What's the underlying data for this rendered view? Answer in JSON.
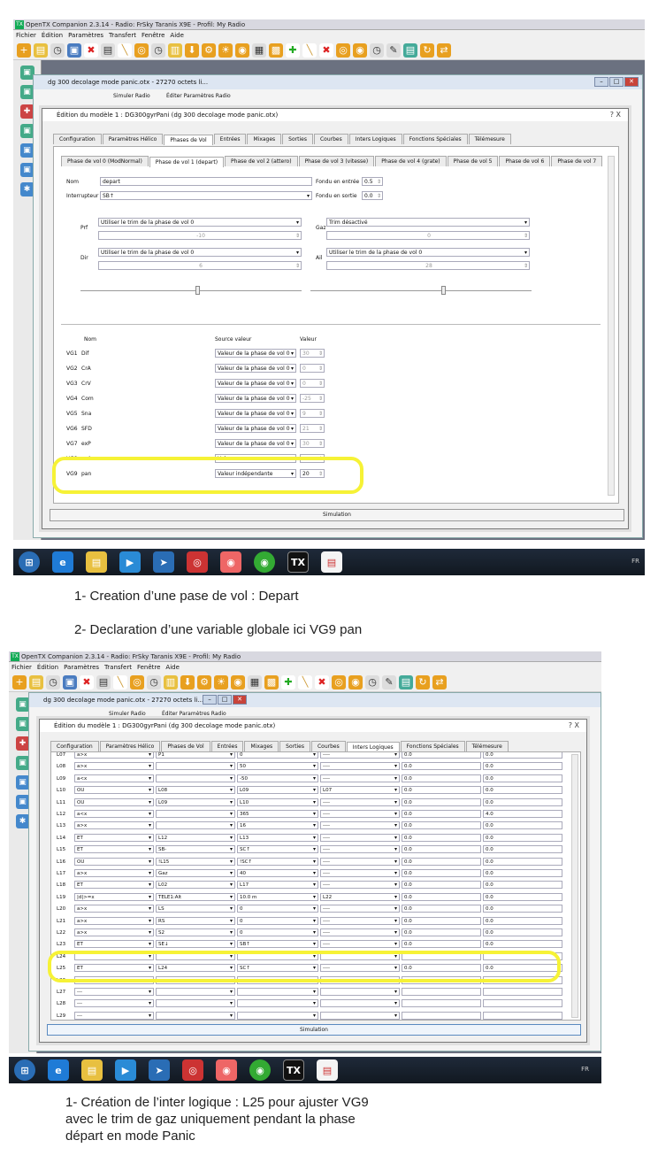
{
  "app_title": "OpenTX Companion 2.3.14 - Radio: FrSky Taranis X9E - Profil: My Radio",
  "menu": [
    "Fichier",
    "Édition",
    "Paramètres",
    "Transfert",
    "Fenêtre",
    "Aide"
  ],
  "mdi_title": "dg 300 decolage mode panic.otx - 27270 octets li...",
  "mdi_actions": {
    "simulate": "Simuler Radio",
    "edit_settings": "Éditer Paramètres Radio"
  },
  "dialog_title": "Édition du modèle 1 : DG300gyrPani   (dg 300 decolage mode panic.otx)",
  "dialog_controls": "?   X",
  "model_tabs": [
    "Configuration",
    "Paramètres Hélico",
    "Phases de Vol",
    "Entrées",
    "Mixages",
    "Sorties",
    "Courbes",
    "Inters Logiques",
    "Fonctions Spéciales",
    "Télémesure"
  ],
  "phase_tabs": [
    "Phase de vol 0 (ModNormal)",
    "Phase de vol 1 (depart)",
    "Phase de vol 2 (attero)",
    "Phase de vol 3 (vitesse)",
    "Phase de vol 4 (grate)",
    "Phase de vol 5",
    "Phase de vol 6",
    "Phase de vol 7"
  ],
  "phase": {
    "name_label": "Nom",
    "name_value": "depart",
    "switch_label": "Interrupteur",
    "switch_value": "SB↑",
    "fade_in_label": "Fondu en entrée",
    "fade_in_value": "0.5",
    "fade_out_label": "Fondu en sortie",
    "fade_out_value": "0.0",
    "trims": [
      {
        "label": "Prf",
        "mode": "Utiliser le trim de la phase de vol 0",
        "value": "-10"
      },
      {
        "label": "Dir",
        "mode": "Utiliser le trim de la phase de vol 0",
        "value": "6"
      },
      {
        "label": "Gaz",
        "mode": "Trim désactivé",
        "value": "0"
      },
      {
        "label": "Ail",
        "mode": "Utiliser le trim de la phase de vol 0",
        "value": "28"
      }
    ]
  },
  "gvars_header": {
    "name": "Nom",
    "source": "Source valeur",
    "value": "Valeur"
  },
  "gvars": [
    {
      "id": "VG1",
      "name": "Dif",
      "source": "Valeur de la phase de vol 0",
      "value": "30"
    },
    {
      "id": "VG2",
      "name": "CrA",
      "source": "Valeur de la phase de vol 0",
      "value": "0"
    },
    {
      "id": "VG3",
      "name": "CrV",
      "source": "Valeur de la phase de vol 0",
      "value": "0"
    },
    {
      "id": "VG4",
      "name": "Com",
      "source": "Valeur de la phase de vol 0",
      "value": "-25"
    },
    {
      "id": "VG5",
      "name": "Sna",
      "source": "Valeur de la phase de vol 0",
      "value": "9"
    },
    {
      "id": "VG6",
      "name": "SFD",
      "source": "Valeur de la phase de vol 0",
      "value": "21"
    },
    {
      "id": "VG7",
      "name": "exP",
      "source": "Valeur de la phase de vol 0",
      "value": "30"
    },
    {
      "id": "VG8",
      "name": "exA",
      "source": "Val...",
      "value": ""
    },
    {
      "id": "VG9",
      "name": "pan",
      "source": "Valeur indépendante",
      "value": "20"
    }
  ],
  "simulation_label": "Simulation",
  "taskbar_lang": "FR",
  "caption1": "1- Creation d’une pase de vol : Depart",
  "caption2": "2- Declaration d’une variable globale ici VG9 pan",
  "logic_switches": [
    {
      "id": "L07",
      "func": "a>x",
      "v1": "P1",
      "v2": "0",
      "and": "----",
      "dur": "0.0",
      "delay": "0.0"
    },
    {
      "id": "L08",
      "func": "a>x",
      "v1": "",
      "v2": "50",
      "and": "----",
      "dur": "0.0",
      "delay": "0.0"
    },
    {
      "id": "L09",
      "func": "a<x",
      "v1": "",
      "v2": "-50",
      "and": "----",
      "dur": "0.0",
      "delay": "0.0"
    },
    {
      "id": "L10",
      "func": "OU",
      "v1": "L08",
      "v2": "L09",
      "and": "L07",
      "dur": "0.0",
      "delay": "0.0"
    },
    {
      "id": "L11",
      "func": "OU",
      "v1": "L09",
      "v2": "L10",
      "and": "----",
      "dur": "0.0",
      "delay": "0.0"
    },
    {
      "id": "L12",
      "func": "a<x",
      "v1": "",
      "v2": "365",
      "and": "----",
      "dur": "0.0",
      "delay": "4.0"
    },
    {
      "id": "L13",
      "func": "a>x",
      "v1": "",
      "v2": "16",
      "and": "----",
      "dur": "0.0",
      "delay": "0.0"
    },
    {
      "id": "L14",
      "func": "ET",
      "v1": "L12",
      "v2": "L13",
      "and": "----",
      "dur": "0.0",
      "delay": "0.0"
    },
    {
      "id": "L15",
      "func": "ET",
      "v1": "SB-",
      "v2": "SC↑",
      "and": "----",
      "dur": "0.0",
      "delay": "0.0"
    },
    {
      "id": "L16",
      "func": "OU",
      "v1": "!L15",
      "v2": "!SC↑",
      "and": "----",
      "dur": "0.0",
      "delay": "0.0"
    },
    {
      "id": "L17",
      "func": "a>x",
      "v1": "Gaz",
      "v2": "40",
      "and": "----",
      "dur": "0.0",
      "delay": "0.0"
    },
    {
      "id": "L18",
      "func": "ET",
      "v1": "L02",
      "v2": "L17",
      "and": "----",
      "dur": "0.0",
      "delay": "0.0"
    },
    {
      "id": "L19",
      "func": "|d|>=x",
      "v1": "TELE1:Alt",
      "v2": "10.0 m",
      "and": "L22",
      "dur": "0.0",
      "delay": "0.0"
    },
    {
      "id": "L20",
      "func": "a>x",
      "v1": "LS",
      "v2": "0",
      "and": "----",
      "dur": "0.0",
      "delay": "0.0"
    },
    {
      "id": "L21",
      "func": "a>x",
      "v1": "RS",
      "v2": "0",
      "and": "----",
      "dur": "0.0",
      "delay": "0.0"
    },
    {
      "id": "L22",
      "func": "a>x",
      "v1": "S2",
      "v2": "0",
      "and": "----",
      "dur": "0.0",
      "delay": "0.0"
    },
    {
      "id": "L23",
      "func": "ET",
      "v1": "SE↓",
      "v2": "SB↑",
      "and": "----",
      "dur": "0.0",
      "delay": "0.0"
    },
    {
      "id": "L24",
      "func": "",
      "v1": "",
      "v2": "",
      "and": "",
      "dur": "",
      "delay": ""
    },
    {
      "id": "L25",
      "func": "ET",
      "v1": "L24",
      "v2": "SC↑",
      "and": "----",
      "dur": "0.0",
      "delay": "0.0"
    },
    {
      "id": "L26",
      "func": "",
      "v1": "",
      "v2": "",
      "and": "",
      "dur": "",
      "delay": ""
    },
    {
      "id": "L27",
      "func": "---",
      "v1": "",
      "v2": "",
      "and": "",
      "dur": "",
      "delay": ""
    },
    {
      "id": "L28",
      "func": "---",
      "v1": "",
      "v2": "",
      "and": "",
      "dur": "",
      "delay": ""
    },
    {
      "id": "L29",
      "func": "---",
      "v1": "",
      "v2": "",
      "and": "",
      "dur": "",
      "delay": ""
    }
  ],
  "caption3": "1- Création de l’inter logique : L25 pour ajuster VG9\navec le trim de gaz uniquement pendant la phase\ndépart en mode Panic"
}
